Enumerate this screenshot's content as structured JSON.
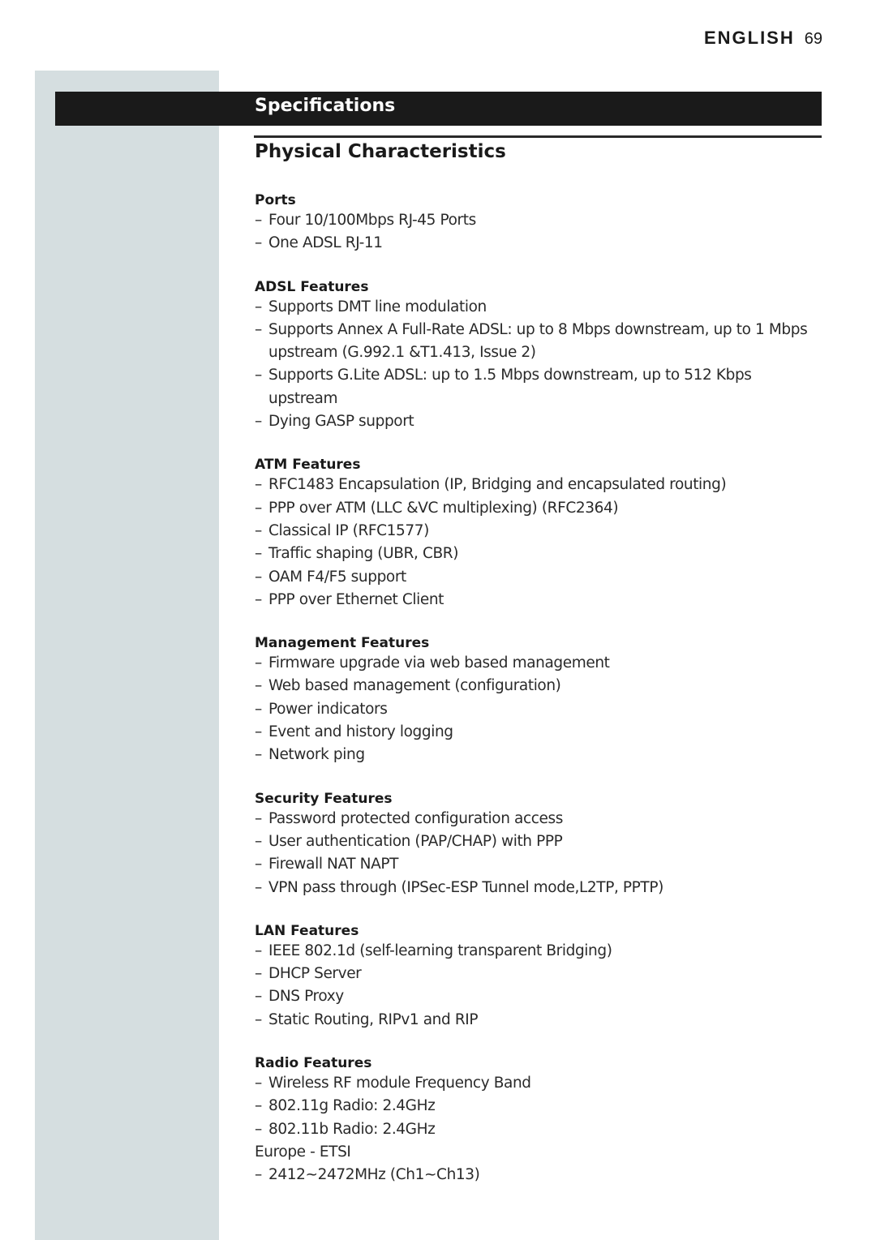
{
  "header": {
    "language": "ENGLISH",
    "page_number": "69"
  },
  "title": "Specifications",
  "subtitle": "Physical Characteristics",
  "dash": "–",
  "sections": [
    {
      "heading": "Ports",
      "items": [
        {
          "dash": true,
          "text": "Four 10/100Mbps RJ-45 Ports"
        },
        {
          "dash": true,
          "text": "One ADSL RJ-11"
        }
      ]
    },
    {
      "heading": "ADSL Features",
      "items": [
        {
          "dash": true,
          "text": "Supports DMT line modulation"
        },
        {
          "dash": true,
          "text": "Supports Annex A Full-Rate ADSL: up to 8 Mbps downstream, up to 1 Mbps upstream (G.992.1 &T1.413, Issue 2)"
        },
        {
          "dash": true,
          "text": "Supports G.Lite ADSL: up to 1.5 Mbps downstream, up to 512 Kbps upstream"
        },
        {
          "dash": true,
          "text": "Dying GASP support"
        }
      ]
    },
    {
      "heading": "ATM Features",
      "items": [
        {
          "dash": true,
          "text": "RFC1483 Encapsulation (IP, Bridging and encapsulated routing)"
        },
        {
          "dash": true,
          "text": "PPP over ATM (LLC &VC multiplexing) (RFC2364)"
        },
        {
          "dash": true,
          "text": "Classical IP (RFC1577)"
        },
        {
          "dash": true,
          "text": "Traffic shaping (UBR, CBR)"
        },
        {
          "dash": true,
          "text": "OAM F4/F5 support"
        },
        {
          "dash": true,
          "text": "PPP over Ethernet Client"
        }
      ]
    },
    {
      "heading": "Management Features",
      "items": [
        {
          "dash": true,
          "text": "Firmware upgrade via web based management"
        },
        {
          "dash": true,
          "text": "Web based management (configuration)"
        },
        {
          "dash": true,
          "text": "Power indicators"
        },
        {
          "dash": true,
          "text": "Event and history logging"
        },
        {
          "dash": true,
          "text": "Network ping"
        }
      ]
    },
    {
      "heading": "Security Features",
      "items": [
        {
          "dash": true,
          "text": "Password protected configuration access"
        },
        {
          "dash": true,
          "text": "User authentication (PAP/CHAP) with PPP"
        },
        {
          "dash": true,
          "text": "Firewall NAT NAPT"
        },
        {
          "dash": true,
          "text": "VPN pass through (IPSec-ESP Tunnel mode,L2TP, PPTP)"
        }
      ]
    },
    {
      "heading": "LAN Features",
      "items": [
        {
          "dash": true,
          "text": "IEEE 802.1d (self-learning transparent Bridging)"
        },
        {
          "dash": true,
          "text": "DHCP Server"
        },
        {
          "dash": true,
          "text": "DNS Proxy"
        },
        {
          "dash": true,
          "text": "Static Routing, RIPv1 and RIP"
        }
      ]
    },
    {
      "heading": "Radio Features",
      "items": [
        {
          "dash": true,
          "text": "Wireless RF module Frequency Band"
        },
        {
          "dash": true,
          "text": "802.11g Radio: 2.4GHz"
        },
        {
          "dash": true,
          "text": "802.11b Radio: 2.4GHz"
        },
        {
          "dash": false,
          "text": "Europe - ETSI"
        },
        {
          "dash": true,
          "text": "2412~2472MHz (Ch1~Ch13)"
        }
      ]
    }
  ]
}
